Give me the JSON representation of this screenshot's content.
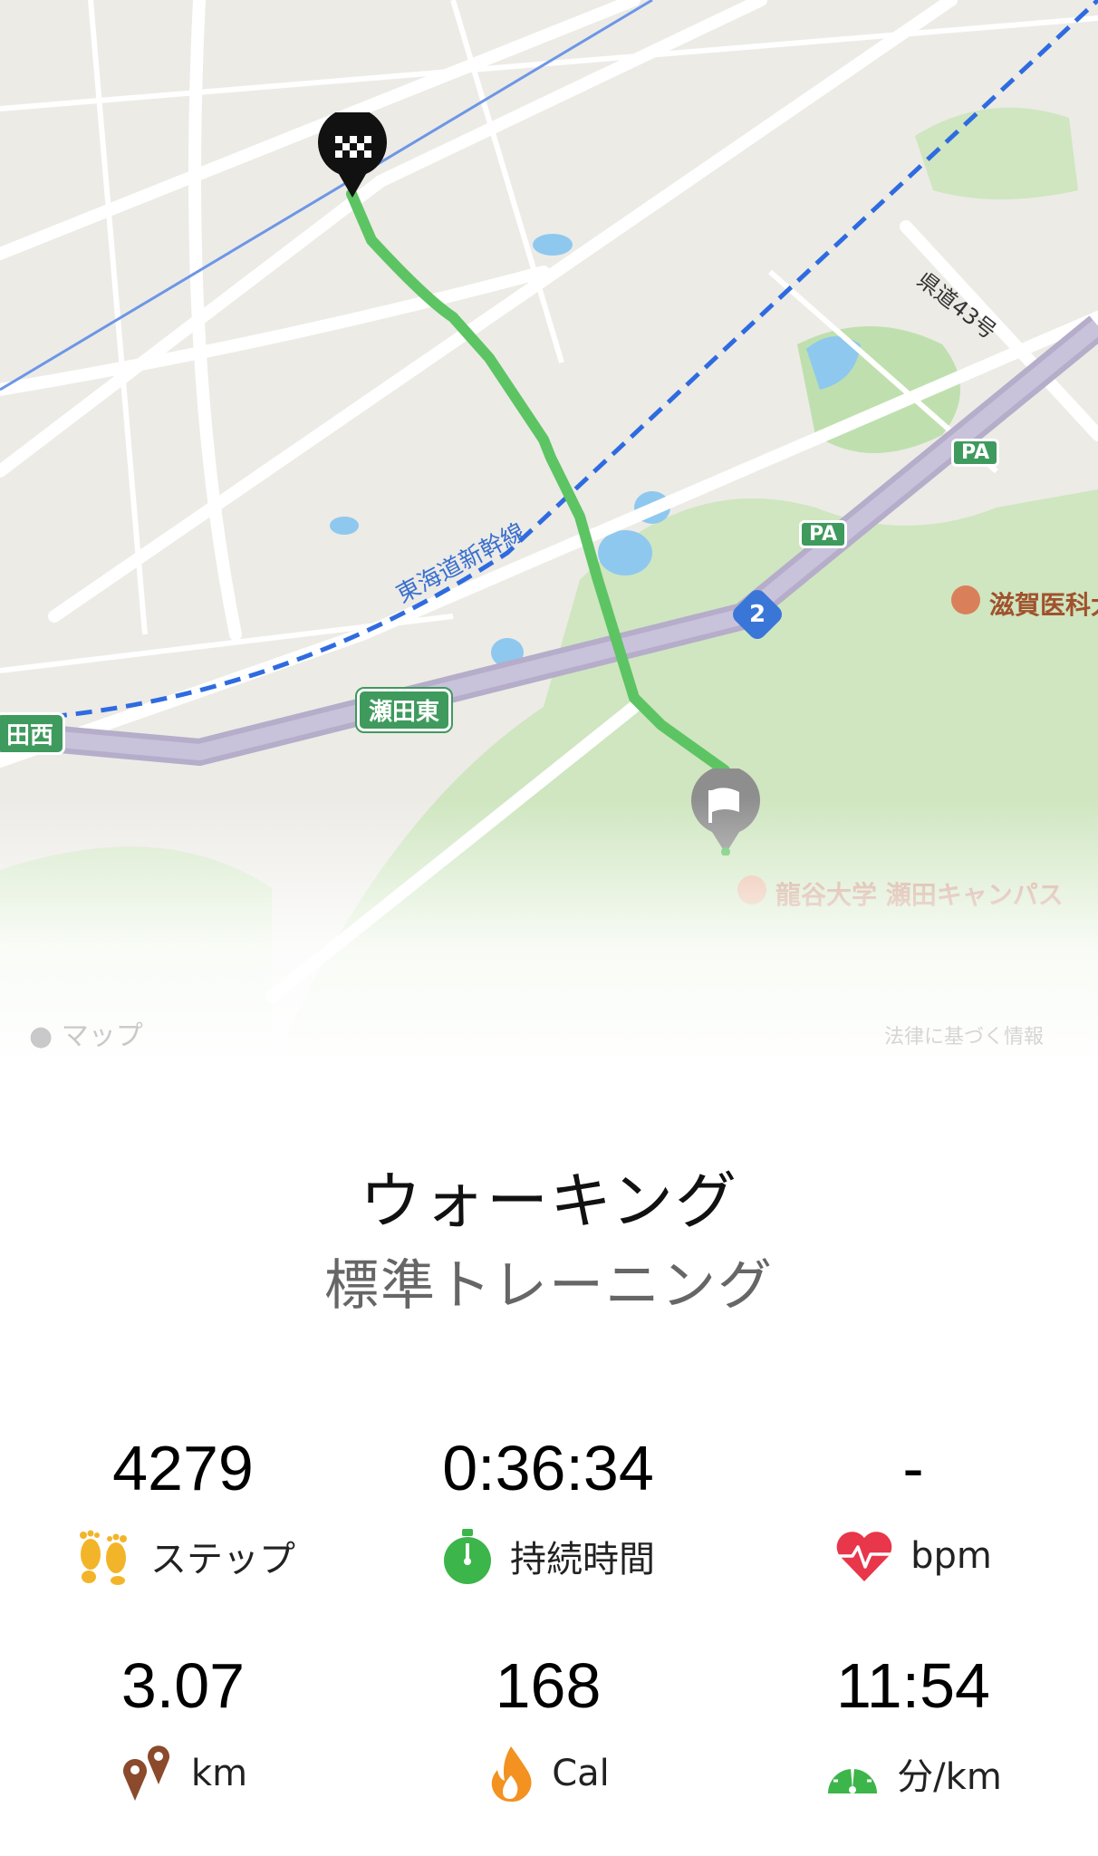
{
  "map": {
    "station_label_1": "瀬田東",
    "station_label_2": "田西",
    "road_number": "2",
    "pa_label": "PA",
    "shinkansen_label": "東海道新幹線",
    "prefectural_road_label": "県道43号",
    "poi_university": "龍谷大学 瀬田キャンパス",
    "poi_medical": "滋賀医科大",
    "attribution_left": "マップ",
    "attribution_right": "法律に基づく情報",
    "route_color": "#5dc463",
    "start_pin_icon": "flag-icon",
    "end_pin_icon": "checkered-flag-icon"
  },
  "workout": {
    "title": "ウォーキング",
    "subtitle": "標準トレーニング"
  },
  "stats": [
    {
      "value": "4279",
      "label": "ステップ",
      "icon": "footprints-icon",
      "color": "#f2b52a"
    },
    {
      "value": "0:36:34",
      "label": "持続時間",
      "icon": "stopwatch-icon",
      "color": "#3cb54a"
    },
    {
      "value": "-",
      "label": "bpm",
      "icon": "heart-rate-icon",
      "color": "#e8364a"
    },
    {
      "value": "3.07",
      "label": "km",
      "icon": "location-pins-icon",
      "color": "#8b4a2b"
    },
    {
      "value": "168",
      "label": "Cal",
      "icon": "flame-icon",
      "color": "#f39121"
    },
    {
      "value": "11:54",
      "label": "分/km",
      "icon": "speedometer-icon",
      "color": "#3cb54a"
    }
  ]
}
